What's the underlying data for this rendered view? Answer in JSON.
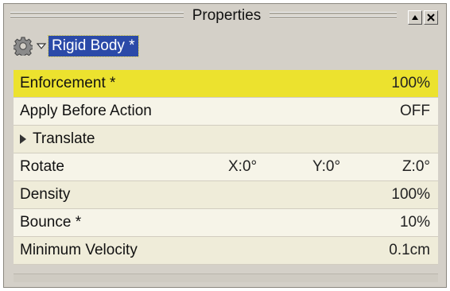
{
  "window": {
    "title": "Properties",
    "buttons": [
      "pin-up",
      "close"
    ]
  },
  "section": {
    "title": "Rigid Body *",
    "icon": "gear-icon",
    "expand_icon": "caret-down-icon"
  },
  "properties": [
    {
      "label": "Enforcement *",
      "value": "100%",
      "selected": true
    },
    {
      "label": "Apply Before Action",
      "value": "OFF"
    },
    {
      "label": "Translate",
      "collapsed": true
    },
    {
      "label": "Rotate",
      "x": "X:0°",
      "y": "Y:0°",
      "z": "Z:0°"
    },
    {
      "label": "Density",
      "value": "100%"
    },
    {
      "label": "Bounce *",
      "value": "10%"
    },
    {
      "label": "Minimum Velocity",
      "value": "0.1cm"
    }
  ],
  "colors": {
    "panel": "#d4d0c8",
    "selection_highlight": "#ece22e",
    "title_highlight": "#2b4aa8",
    "row_light": "#f6f4e8",
    "row_dark": "#efecd9"
  }
}
